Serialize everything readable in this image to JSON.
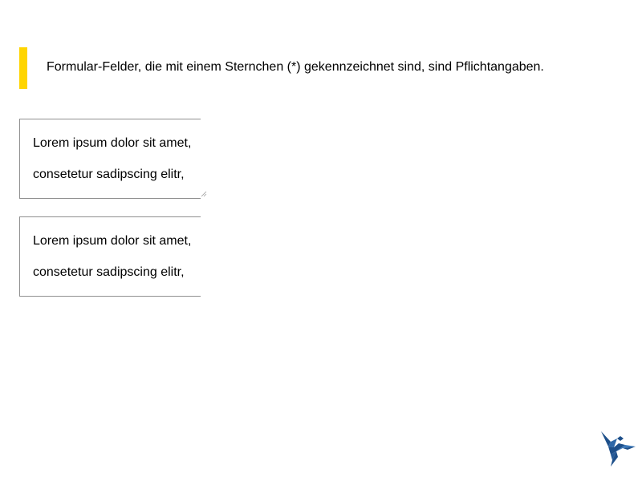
{
  "notice": {
    "text": "Formular-Felder, die mit einem Sternchen (*) gekennzeichnet sind, sind Pflichtangaben.",
    "accent_color": "#FFD500"
  },
  "fields": [
    {
      "line1": "Lorem ipsum dolor sit amet,",
      "line2": "consetetur sadipscing elitr,",
      "resizable": true
    },
    {
      "line1": "Lorem ipsum dolor sit amet,",
      "line2": "consetetur sadipscing elitr,",
      "resizable": false
    }
  ],
  "logo": {
    "icon": "bird-logo-icon",
    "color": "#1d4f8a"
  }
}
